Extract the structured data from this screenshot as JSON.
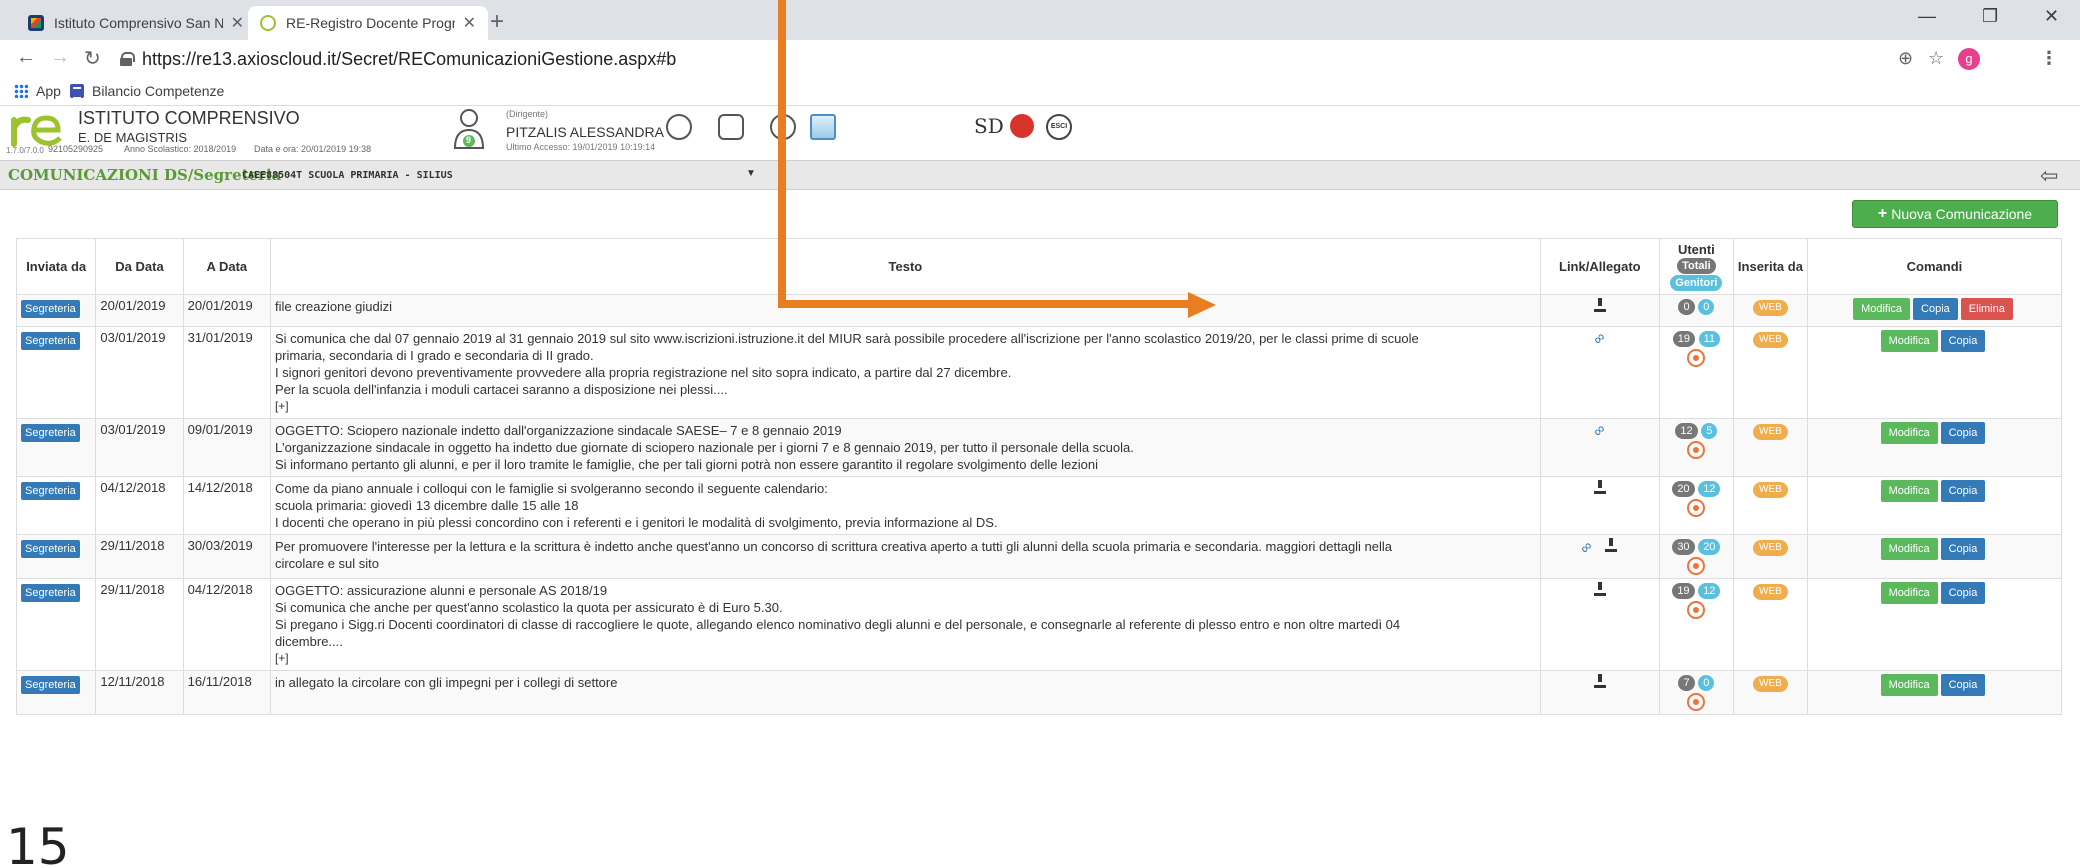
{
  "browser": {
    "tabs": [
      {
        "title": "Istituto Comprensivo San Nicolò",
        "active": false
      },
      {
        "title": "RE-Registro Docente Programma",
        "active": true
      }
    ],
    "new_tab": "+",
    "url": "https://re13.axioscloud.it/Secret/REComunicazioniGestione.aspx#b",
    "avatar_letter": "g",
    "bookmarks": [
      "App",
      "Bilancio Competenze"
    ]
  },
  "header": {
    "school_name": "ISTITUTO COMPRENSIVO",
    "school_sub": "E. DE MAGISTRIS",
    "version": "1.7.0/7.0.0",
    "code": "92105290925",
    "year": "Anno Scolastico: 2018/2019",
    "datetime": "Data e ora: 20/01/2019 19:38",
    "user_badge": "9",
    "role": "(Dirigente)",
    "user": "PITZALIS ALESSANDRA",
    "last_access": "Ultimo Accesso: 19/01/2019 10:19:14",
    "sd_logo": "SD",
    "esci": "ESCI"
  },
  "section": {
    "title": "COMUNICAZIONI DS/Segreteria",
    "class": "CAEE88504T SCUOLA PRIMARIA - SILIUS",
    "dropdown": "▼"
  },
  "new_button": "Nuova Comunicazione",
  "table": {
    "headers": {
      "inviata": "Inviata da",
      "da_data": "Da Data",
      "a_data": "A Data",
      "testo": "Testo",
      "link": "Link/Allegato",
      "utenti": "Utenti",
      "totali": "Totali",
      "genitori": "Genitori",
      "inserita": "Inserita da",
      "comandi": "Comandi"
    },
    "labels": {
      "segreteria": "Segreteria",
      "web": "WEB",
      "modifica": "Modifica",
      "copia": "Copia",
      "elimina": "Elimina",
      "more": "[+]"
    },
    "rows": [
      {
        "from": "20/01/2019",
        "to": "20/01/2019",
        "text": [
          "file creazione giudizi"
        ],
        "tot": "0",
        "gen": "0"
      },
      {
        "from": "03/01/2019",
        "to": "31/01/2019",
        "text": [
          "Si comunica che dal 07 gennaio 2019 al 31 gennaio 2019 sul sito www.iscrizioni.istruzione.it del MIUR sarà possibile procedere all'iscrizione per l'anno scolastico 2019/20, per le classi prime di scuole",
          "primaria, secondaria di I grado e secondaria di II grado.",
          "I signori genitori devono preventivamente provvedere alla propria registrazione nel sito sopra indicato, a partire dal 27 dicembre.",
          "Per la scuola dell'infanzia i moduli cartacei saranno a disposizione nei plessi...."
        ],
        "tot": "19",
        "gen": "11"
      },
      {
        "from": "03/01/2019",
        "to": "09/01/2019",
        "text": [
          "OGGETTO: Sciopero nazionale indetto dall'organizzazione sindacale SAESE– 7 e 8 gennaio 2019",
          "L'organizzazione sindacale in oggetto ha indetto due giornate di sciopero nazionale per i giorni 7 e 8 gennaio 2019, per tutto il personale della scuola.",
          "Si informano pertanto gli alunni, e per il loro tramite le famiglie, che per tali giorni potrà non essere garantito il regolare svolgimento delle lezioni"
        ],
        "tot": "12",
        "gen": "5"
      },
      {
        "from": "04/12/2018",
        "to": "14/12/2018",
        "text": [
          "Come da piano annuale i colloqui con le famiglie si svolgeranno secondo il seguente calendario:",
          "scuola primaria: giovedì 13 dicembre dalle 15 alle 18",
          "I docenti che operano in più plessi concordino con i referenti e i genitori le modalità di svolgimento, previa informazione al DS."
        ],
        "tot": "20",
        "gen": "12"
      },
      {
        "from": "29/11/2018",
        "to": "30/03/2019",
        "text": [
          "Per promuovere l'interesse per la lettura e la scrittura è indetto anche quest'anno un concorso di scrittura creativa aperto a tutti gli alunni della scuola primaria e secondaria. maggiori dettagli nella",
          "circolare e sul sito"
        ],
        "tot": "30",
        "gen": "20"
      },
      {
        "from": "29/11/2018",
        "to": "04/12/2018",
        "text": [
          "OGGETTO: assicurazione alunni e personale AS 2018/19",
          "Si comunica che anche per quest'anno scolastico la quota per assicurato è di Euro 5.30.",
          "Si pregano i Sigg.ri Docenti coordinatori di classe di raccogliere le quote, allegando elenco nominativo degli alunni e del personale, e consegnarle al referente di plesso entro e non oltre martedì 04",
          "dicembre...."
        ],
        "tot": "19",
        "gen": "12"
      },
      {
        "from": "12/11/2018",
        "to": "16/11/2018",
        "text": [
          "in allegato la circolare con gli impegni per i collegi di settore"
        ],
        "tot": "7",
        "gen": "0"
      }
    ]
  },
  "slide_number": "15",
  "colors": {
    "accent_green": "#5cb85c",
    "label_blue": "#337ab7",
    "danger": "#d9534f",
    "arrow": "#e87d22"
  }
}
